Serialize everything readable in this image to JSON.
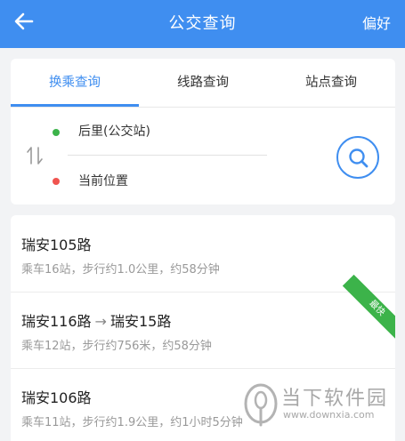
{
  "header": {
    "title": "公交查询",
    "preferences_label": "偏好",
    "bg_color": "#3f8ef0"
  },
  "tabs": [
    {
      "label": "换乘查询",
      "active": true
    },
    {
      "label": "线路查询",
      "active": false
    },
    {
      "label": "站点查询",
      "active": false
    }
  ],
  "search": {
    "origin": "后里(公交站)",
    "destination": "当前位置"
  },
  "routes": [
    {
      "title": "瑞安105路",
      "detail": "乘车16站，步行约1.0公里，约58分钟"
    },
    {
      "title_part1": "瑞安116路",
      "arrow": "→",
      "title_part2": "瑞安15路",
      "detail": "乘车12站，步行约756米，约58分钟",
      "badge": "最快"
    },
    {
      "title": "瑞安106路",
      "detail": "乘车11站，步行约1.9公里，约1小时5分钟"
    }
  ],
  "watermark": {
    "name": "当下软件园",
    "url": "www.downxia.com"
  },
  "colors": {
    "accent": "#3f8ef0",
    "origin_dot": "#3cb34a",
    "destination_dot": "#f0544f",
    "badge": "#3cb34a"
  }
}
